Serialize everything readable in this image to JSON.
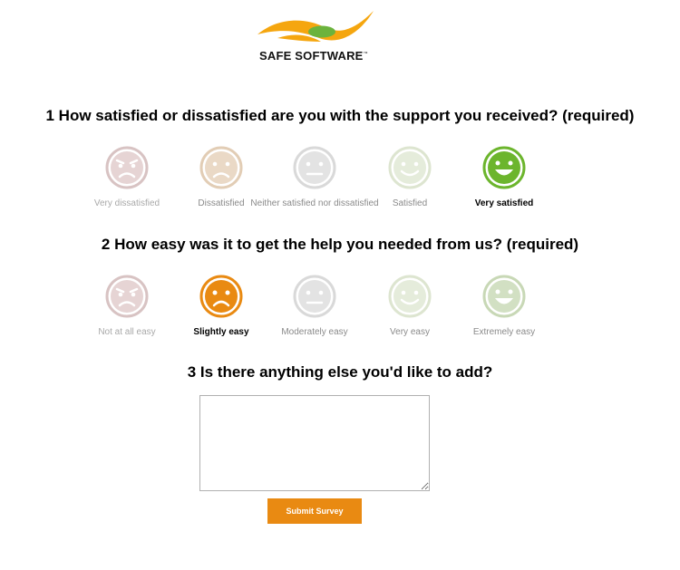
{
  "brand": {
    "name": "SAFE SOFTWARE",
    "trademark": "™",
    "colors": {
      "swoosh": "#f5a60f",
      "oval": "#6bb33d"
    }
  },
  "questions": [
    {
      "title": "1 How satisfied or dissatisfied are you with the support you received? (required)",
      "selected": "Very satisfied",
      "options": [
        {
          "label": "Very dissatisfied",
          "face": "angry-face-icon",
          "color": "#d8c3c3"
        },
        {
          "label": "Dissatisfied",
          "face": "sad-face-icon",
          "color": "#e2cdb5"
        },
        {
          "label": "Neither satisfied nor dissatisfied",
          "face": "neutral-face-icon",
          "color": "#d9d9d9"
        },
        {
          "label": "Satisfied",
          "face": "smile-face-icon",
          "color": "#dde5d0"
        },
        {
          "label": "Very satisfied",
          "face": "big-smile-face-icon",
          "color": "#6cb52d"
        }
      ]
    },
    {
      "title": "2 How easy was it to get the help you needed from us? (required)",
      "selected": "Slightly easy",
      "options": [
        {
          "label": "Not at all easy",
          "face": "angry-face-icon",
          "color": "#d8c3c3"
        },
        {
          "label": "Slightly easy",
          "face": "sad-face-icon",
          "color": "#e98a12"
        },
        {
          "label": "Moderately easy",
          "face": "neutral-face-icon",
          "color": "#d9d9d9"
        },
        {
          "label": "Very easy",
          "face": "smile-face-icon",
          "color": "#dde5d0"
        },
        {
          "label": "Extremely easy",
          "face": "big-smile-face-icon",
          "color": "#c8d8b6"
        }
      ]
    },
    {
      "title": "3 Is there anything else you'd like to add?"
    }
  ],
  "comment": {
    "value": "",
    "placeholder": ""
  },
  "submit_label": "Submit Survey"
}
